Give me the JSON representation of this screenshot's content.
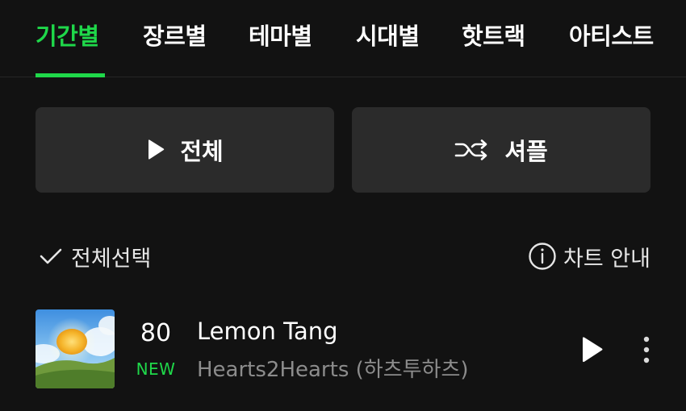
{
  "tabs": [
    {
      "label": "기간별",
      "active": true
    },
    {
      "label": "장르별",
      "active": false
    },
    {
      "label": "테마별",
      "active": false
    },
    {
      "label": "시대별",
      "active": false
    },
    {
      "label": "핫트랙",
      "active": false
    },
    {
      "label": "아티스트",
      "active": false
    }
  ],
  "actions": {
    "play_all_label": "전체",
    "shuffle_label": "셔플"
  },
  "list_controls": {
    "select_all_label": "전체선택",
    "chart_info_label": "차트 안내"
  },
  "songs": [
    {
      "rank": "80",
      "badge": "NEW",
      "title": "Lemon Tang",
      "artist": "Hearts2Hearts (하츠투하츠)"
    }
  ],
  "colors": {
    "accent": "#1fd84a",
    "background": "#121212",
    "button_bg": "#2b2b2b",
    "secondary_text": "#8c8c8c"
  },
  "icons": {
    "play": "play-icon",
    "shuffle": "shuffle-icon",
    "check": "check-icon",
    "info": "info-icon",
    "more": "more-vertical-icon"
  }
}
